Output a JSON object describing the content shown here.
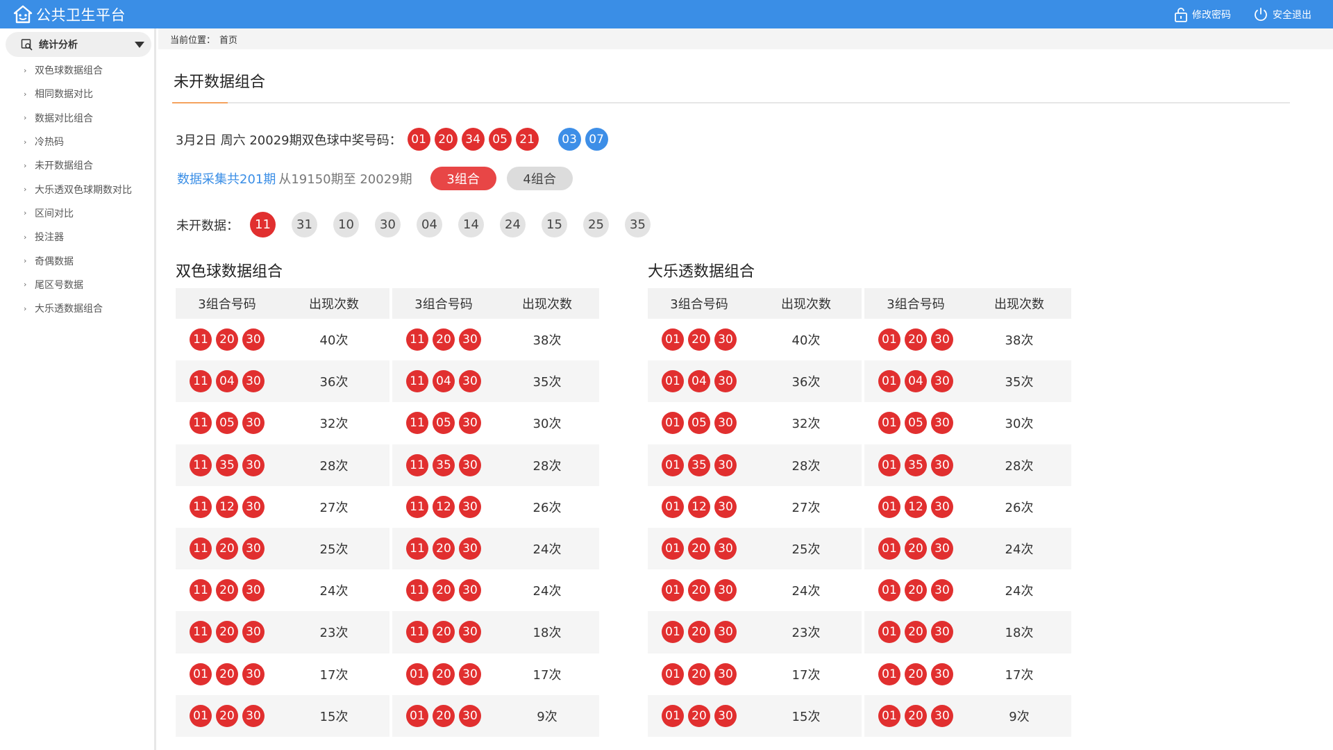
{
  "app": {
    "title": "公共卫生平台",
    "actions": [
      {
        "label": "修改密码",
        "icon": "lock-icon"
      },
      {
        "label": "安全退出",
        "icon": "power-icon"
      }
    ]
  },
  "sidebar": {
    "group_label": "统计分析",
    "items": [
      {
        "label": "双色球数据组合"
      },
      {
        "label": "相同数据对比"
      },
      {
        "label": "数据对比组合"
      },
      {
        "label": "冷热码"
      },
      {
        "label": "未开数据组合"
      },
      {
        "label": "大乐透双色球期数对比"
      },
      {
        "label": "区间对比"
      },
      {
        "label": "投注器"
      },
      {
        "label": "奇偶数据"
      },
      {
        "label": "尾区号数据"
      },
      {
        "label": "大乐透数据组合"
      }
    ]
  },
  "breadcrumb": {
    "prefix": "当前位置：",
    "current": "首页"
  },
  "page": {
    "title": "未开数据组合"
  },
  "draw": {
    "label": "3月2日 周六 20029期双色球中奖号码：",
    "red": [
      "01",
      "20",
      "34",
      "05",
      "21"
    ],
    "blue": [
      "03",
      "07"
    ]
  },
  "collect": {
    "highlight": "数据采集共201期",
    "range": "从19150期至 20029期",
    "tabs": [
      {
        "label": "3组合",
        "active": true
      },
      {
        "label": "4组合",
        "active": false
      }
    ]
  },
  "missing": {
    "label": "未开数据：",
    "numbers": [
      {
        "value": "11",
        "highlight": true
      },
      {
        "value": "31",
        "highlight": false
      },
      {
        "value": "10",
        "highlight": false
      },
      {
        "value": "30",
        "highlight": false
      },
      {
        "value": "04",
        "highlight": false
      },
      {
        "value": "14",
        "highlight": false
      },
      {
        "value": "24",
        "highlight": false
      },
      {
        "value": "15",
        "highlight": false
      },
      {
        "value": "25",
        "highlight": false
      },
      {
        "value": "35",
        "highlight": false
      }
    ]
  },
  "tables": [
    {
      "title": "双色球数据组合",
      "headers": [
        "3组合号码",
        "出现次数",
        "3组合号码",
        "出现次数"
      ],
      "rows": [
        {
          "left": {
            "balls": [
              "11",
              "20",
              "30"
            ],
            "count": "40次"
          },
          "right": {
            "balls": [
              "11",
              "20",
              "30"
            ],
            "count": "38次"
          }
        },
        {
          "left": {
            "balls": [
              "11",
              "04",
              "30"
            ],
            "count": "36次"
          },
          "right": {
            "balls": [
              "11",
              "04",
              "30"
            ],
            "count": "35次"
          }
        },
        {
          "left": {
            "balls": [
              "11",
              "05",
              "30"
            ],
            "count": "32次"
          },
          "right": {
            "balls": [
              "11",
              "05",
              "30"
            ],
            "count": "30次"
          }
        },
        {
          "left": {
            "balls": [
              "11",
              "35",
              "30"
            ],
            "count": "28次"
          },
          "right": {
            "balls": [
              "11",
              "35",
              "30"
            ],
            "count": "28次"
          }
        },
        {
          "left": {
            "balls": [
              "11",
              "12",
              "30"
            ],
            "count": "27次"
          },
          "right": {
            "balls": [
              "11",
              "12",
              "30"
            ],
            "count": "26次"
          }
        },
        {
          "left": {
            "balls": [
              "11",
              "20",
              "30"
            ],
            "count": "25次"
          },
          "right": {
            "balls": [
              "11",
              "20",
              "30"
            ],
            "count": "24次"
          }
        },
        {
          "left": {
            "balls": [
              "11",
              "20",
              "30"
            ],
            "count": "24次"
          },
          "right": {
            "balls": [
              "11",
              "20",
              "30"
            ],
            "count": "24次"
          }
        },
        {
          "left": {
            "balls": [
              "11",
              "20",
              "30"
            ],
            "count": "23次"
          },
          "right": {
            "balls": [
              "11",
              "20",
              "30"
            ],
            "count": "18次"
          }
        },
        {
          "left": {
            "balls": [
              "01",
              "20",
              "30"
            ],
            "count": "17次"
          },
          "right": {
            "balls": [
              "01",
              "20",
              "30"
            ],
            "count": "17次"
          }
        },
        {
          "left": {
            "balls": [
              "01",
              "20",
              "30"
            ],
            "count": "15次"
          },
          "right": {
            "balls": [
              "01",
              "20",
              "30"
            ],
            "count": "9次"
          }
        }
      ]
    },
    {
      "title": "大乐透数据组合",
      "headers": [
        "3组合号码",
        "出现次数",
        "3组合号码",
        "出现次数"
      ],
      "rows": [
        {
          "left": {
            "balls": [
              "01",
              "20",
              "30"
            ],
            "count": "40次"
          },
          "right": {
            "balls": [
              "01",
              "20",
              "30"
            ],
            "count": "38次"
          }
        },
        {
          "left": {
            "balls": [
              "01",
              "04",
              "30"
            ],
            "count": "36次"
          },
          "right": {
            "balls": [
              "01",
              "04",
              "30"
            ],
            "count": "35次"
          }
        },
        {
          "left": {
            "balls": [
              "01",
              "05",
              "30"
            ],
            "count": "32次"
          },
          "right": {
            "balls": [
              "01",
              "05",
              "30"
            ],
            "count": "30次"
          }
        },
        {
          "left": {
            "balls": [
              "01",
              "35",
              "30"
            ],
            "count": "28次"
          },
          "right": {
            "balls": [
              "01",
              "35",
              "30"
            ],
            "count": "28次"
          }
        },
        {
          "left": {
            "balls": [
              "01",
              "12",
              "30"
            ],
            "count": "27次"
          },
          "right": {
            "balls": [
              "01",
              "12",
              "30"
            ],
            "count": "26次"
          }
        },
        {
          "left": {
            "balls": [
              "01",
              "20",
              "30"
            ],
            "count": "25次"
          },
          "right": {
            "balls": [
              "01",
              "20",
              "30"
            ],
            "count": "24次"
          }
        },
        {
          "left": {
            "balls": [
              "01",
              "20",
              "30"
            ],
            "count": "24次"
          },
          "right": {
            "balls": [
              "01",
              "20",
              "30"
            ],
            "count": "24次"
          }
        },
        {
          "left": {
            "balls": [
              "01",
              "20",
              "30"
            ],
            "count": "23次"
          },
          "right": {
            "balls": [
              "01",
              "20",
              "30"
            ],
            "count": "18次"
          }
        },
        {
          "left": {
            "balls": [
              "01",
              "20",
              "30"
            ],
            "count": "17次"
          },
          "right": {
            "balls": [
              "01",
              "20",
              "30"
            ],
            "count": "17次"
          }
        },
        {
          "left": {
            "balls": [
              "01",
              "20",
              "30"
            ],
            "count": "15次"
          },
          "right": {
            "balls": [
              "01",
              "20",
              "30"
            ],
            "count": "9次"
          }
        }
      ]
    }
  ],
  "colors": {
    "topbar": "#3a8ee6",
    "red_ball": "#e12f2f",
    "blue_ball": "#3d8ee7",
    "accent_rule": "#f5a25d"
  }
}
